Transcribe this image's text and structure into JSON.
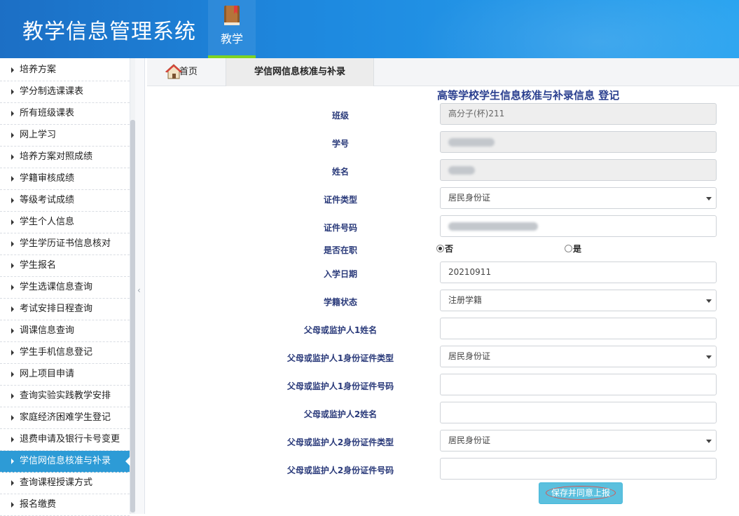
{
  "header": {
    "app_title": "教学信息管理系统",
    "nav_tab_label": "教学"
  },
  "sidebar": {
    "items": [
      {
        "label": "培养方案"
      },
      {
        "label": "学分制选课课表"
      },
      {
        "label": "所有班级课表"
      },
      {
        "label": "网上学习"
      },
      {
        "label": "培养方案对照成绩"
      },
      {
        "label": "学籍审核成绩"
      },
      {
        "label": "等级考试成绩"
      },
      {
        "label": "学生个人信息"
      },
      {
        "label": "学生学历证书信息核对"
      },
      {
        "label": "学生报名"
      },
      {
        "label": "学生选课信息查询"
      },
      {
        "label": "考试安排日程查询"
      },
      {
        "label": "调课信息查询"
      },
      {
        "label": "学生手机信息登记"
      },
      {
        "label": "网上项目申请"
      },
      {
        "label": "查询实验实践教学安排"
      },
      {
        "label": "家庭经济困难学生登记"
      },
      {
        "label": "退费申请及银行卡号变更"
      },
      {
        "label": "学信网信息核准与补录",
        "active": true
      },
      {
        "label": "查询课程授课方式"
      },
      {
        "label": "报名缴费"
      }
    ]
  },
  "tabs": {
    "home": "首页",
    "active": "学信网信息核准与补录"
  },
  "form": {
    "title": "高等学校学生信息核准与补录信息 登记",
    "class_label": "班级",
    "class_value": "高分子(杯)211",
    "student_id_label": "学号",
    "name_label": "姓名",
    "id_type_label": "证件类型",
    "id_type_value": "居民身份证",
    "id_number_label": "证件号码",
    "employed_label": "是否在职",
    "employed_no": "否",
    "employed_yes": "是",
    "enroll_date_label": "入学日期",
    "enroll_date_value": "20210911",
    "status_label": "学籍状态",
    "status_value": "注册学籍",
    "guardian1_name_label": "父母或监护人1姓名",
    "guardian1_idtype_label": "父母或监护人1身份证件类型",
    "guardian1_idtype_value": "居民身份证",
    "guardian1_idnum_label": "父母或监护人1身份证件号码",
    "guardian2_name_label": "父母或监护人2姓名",
    "guardian2_idtype_label": "父母或监护人2身份证件类型",
    "guardian2_idtype_value": "居民身份证",
    "guardian2_idnum_label": "父母或监护人2身份证件号码",
    "save_label": "保存并同意上报"
  },
  "colors": {
    "header_gradient_start": "#1c6fc5",
    "active_sidebar": "#2d9bd6",
    "label_text": "#2a3a7a",
    "save_button": "#5bc0de"
  },
  "icons": {
    "nav_tab": "book-icon",
    "home_tab": "home-icon",
    "splitter": "chevron-left-icon"
  }
}
